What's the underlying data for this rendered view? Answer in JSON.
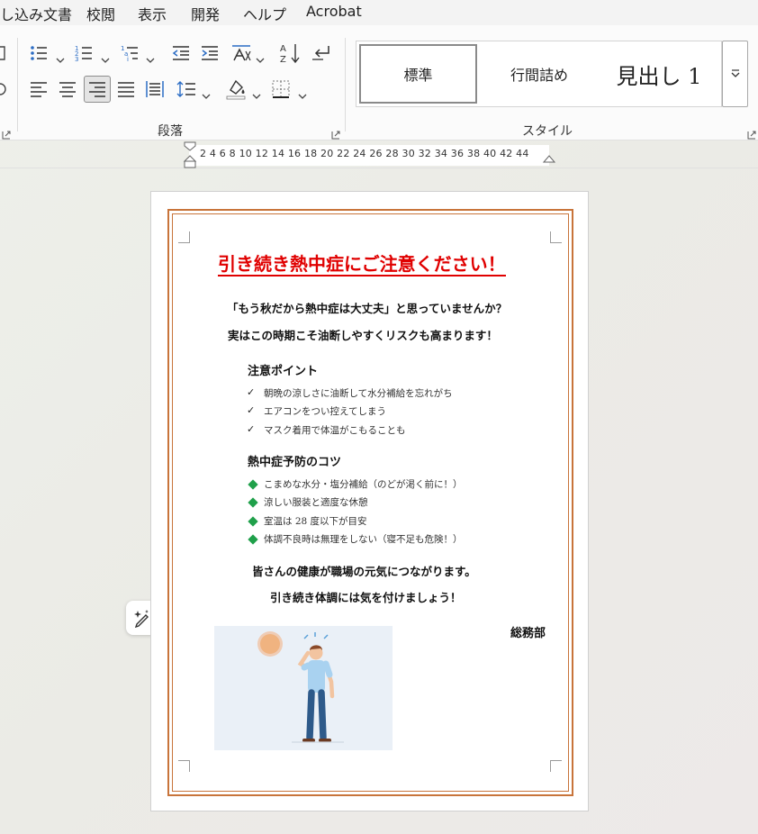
{
  "menu": {
    "items": [
      "し込み文書",
      "校閲",
      "表示",
      "開発",
      "ヘルプ",
      "Acrobat"
    ]
  },
  "ribbon": {
    "paragraph_group_label": "段落",
    "styles_group_label": "スタイル",
    "styles": {
      "normal": "標準",
      "compact": "行間詰め",
      "heading1": "見出し 1"
    }
  },
  "ruler": {
    "numbers": "2  4  6  8 10 12 14 16 18 20 22 24 26 28 30 32 34 36 38 40 42 44"
  },
  "document": {
    "title": "引き続き熱中症にご注意ください！",
    "lead1": "「もう秋だから熱中症は大丈夫」と思っていませんか？",
    "lead2": "実はこの時期こそ油断しやすくリスクも高まります！",
    "caution_heading": "注意ポイント",
    "caution_items": [
      "朝晩の涼しさに油断して水分補給を忘れがち",
      "エアコンをつい控えてしまう",
      "マスク着用で体温がこもることも"
    ],
    "tips_heading": "熱中症予防のコツ",
    "tips_items": [
      "こまめな水分・塩分補給（のどが渇く前に！）",
      "涼しい服装と適度な休憩",
      "室温は 28 度以下が目安",
      "体調不良時は無理をしない（寝不足も危険！）"
    ],
    "closing1": "皆さんの健康が職場の元気につながります。",
    "closing2": "引き続き体調には気を付けましょう！",
    "signature": "総務部"
  },
  "colors": {
    "title_red": "#e00000",
    "page_border": "#c8743a",
    "diamond_green": "#1fa04a",
    "accent_blue": "#2b6cc4"
  }
}
